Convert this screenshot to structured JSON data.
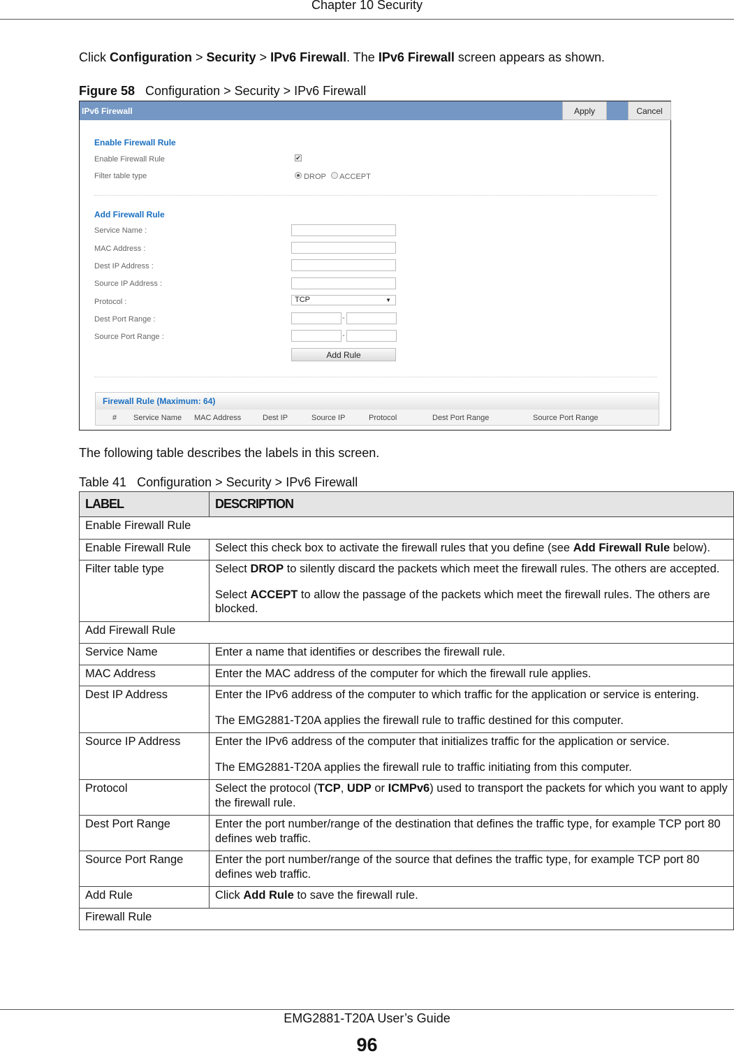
{
  "header": {
    "chapter": "Chapter 10 Security"
  },
  "intro": [
    {
      "t": "Click "
    },
    {
      "t": "Configuration",
      "b": 1
    },
    {
      "t": " > "
    },
    {
      "t": "Security",
      "b": 1
    },
    {
      "t": " > "
    },
    {
      "t": "IPv6 Firewall",
      "b": 1
    },
    {
      "t": ". The "
    },
    {
      "t": "IPv6 Firewall",
      "b": 1
    },
    {
      "t": " screen appears as shown."
    }
  ],
  "figure": {
    "label": "Figure 58",
    "title": "Configuration > Security > IPv6 Firewall"
  },
  "screen": {
    "title": "IPv6 Firewall",
    "apply": "Apply",
    "cancel": "Cancel",
    "enable_section": "Enable Firewall Rule",
    "enable_label": "Enable Firewall Rule",
    "enable_checked": true,
    "filter_label": "Filter table type",
    "drop": "DROP",
    "accept": "ACCEPT",
    "filter_selected": "DROP",
    "add_section": "Add Firewall Rule",
    "service_name": "Service Name :",
    "mac": "MAC Address :",
    "dest_ip": "Dest IP Address :",
    "source_ip": "Source IP Address :",
    "protocol": "Protocol :",
    "protocol_value": "TCP",
    "dest_port": "Dest Port Range :",
    "source_port": "Source Port Range :",
    "dash": "-",
    "add_rule": "Add Rule",
    "rule_title": "Firewall Rule (Maximum: 64)",
    "columns": [
      "#",
      "Service Name",
      "MAC Address",
      "Dest IP",
      "Source IP",
      "Protocol",
      "Dest Port Range",
      "Source Port Range"
    ]
  },
  "table_intro": "The following table describes the labels in this screen.",
  "table_caption": {
    "label": "Table 41",
    "title": "Configuration > Security > IPv6 Firewall"
  },
  "table": {
    "headers": [
      "LABEL",
      "DESCRIPTION"
    ],
    "rows": [
      {
        "section": "Enable Firewall Rule"
      },
      {
        "label": "Enable Firewall Rule",
        "desc": [
          [
            {
              "t": "Select this check box to activate the firewall rules that you define (see "
            },
            {
              "t": "Add Firewall Rule",
              "b": 1
            },
            {
              "t": " below)."
            }
          ]
        ]
      },
      {
        "label": "Filter table type",
        "desc": [
          [
            {
              "t": "Select "
            },
            {
              "t": "DROP",
              "b": 1
            },
            {
              "t": " to silently discard the packets which meet the firewall rules. The others are accepted."
            }
          ],
          [
            {
              "t": "Select "
            },
            {
              "t": "ACCEPT",
              "b": 1
            },
            {
              "t": " to allow the passage of the packets which meet the firewall rules. The others are blocked."
            }
          ]
        ]
      },
      {
        "section": "Add Firewall Rule"
      },
      {
        "label": "Service Name",
        "desc": [
          [
            {
              "t": "Enter a name that identifies or describes the firewall rule."
            }
          ]
        ]
      },
      {
        "label": "MAC Address",
        "desc": [
          [
            {
              "t": "Enter the MAC address of the computer for which the firewall rule applies."
            }
          ]
        ]
      },
      {
        "label": "Dest IP Address",
        "desc": [
          [
            {
              "t": "Enter the IPv6 address of the computer to which traffic for the application or service is entering."
            }
          ],
          [
            {
              "t": "The EMG2881-T20A applies the firewall rule to traffic destined for this computer."
            }
          ]
        ]
      },
      {
        "label": "Source IP Address",
        "desc": [
          [
            {
              "t": "Enter the IPv6 address of the computer that initializes traffic for the application or service."
            }
          ],
          [
            {
              "t": "The EMG2881-T20A applies the firewall rule to traffic initiating from this computer."
            }
          ]
        ]
      },
      {
        "label": "Protocol",
        "desc": [
          [
            {
              "t": "Select the protocol ("
            },
            {
              "t": "TCP",
              "b": 1
            },
            {
              "t": ", "
            },
            {
              "t": "UDP",
              "b": 1
            },
            {
              "t": " or "
            },
            {
              "t": "ICMPv6",
              "b": 1
            },
            {
              "t": ") used to transport the packets for which you want to apply the firewall rule."
            }
          ]
        ]
      },
      {
        "label": "Dest Port Range",
        "desc": [
          [
            {
              "t": "Enter the port number/range of the destination that defines the traffic type, for example TCP port 80 defines web traffic."
            }
          ]
        ]
      },
      {
        "label": "Source Port Range",
        "desc": [
          [
            {
              "t": "Enter the port number/range of the source that defines the traffic type, for example TCP port 80 defines web traffic."
            }
          ]
        ]
      },
      {
        "label": "Add Rule",
        "desc": [
          [
            {
              "t": "Click "
            },
            {
              "t": "Add Rule",
              "b": 1
            },
            {
              "t": " to save the firewall rule."
            }
          ]
        ]
      },
      {
        "section": "Firewall Rule"
      }
    ]
  },
  "footer": {
    "guide": "EMG2881-T20A User’s Guide",
    "page": "96"
  }
}
